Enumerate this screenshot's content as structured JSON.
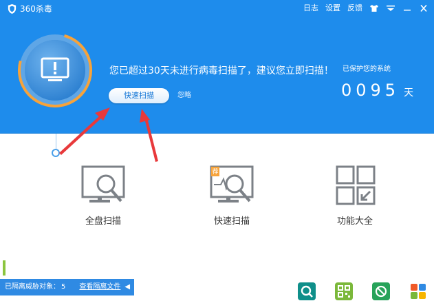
{
  "app": {
    "title": "360杀毒"
  },
  "menu": {
    "log": "日志",
    "settings": "设置",
    "feedback": "反馈",
    "skin_icon": "shirt-icon",
    "menu_icon": "menu-icon",
    "minimize_icon": "minimize-icon",
    "close_icon": "close-icon"
  },
  "banner": {
    "status_icon": "monitor-alert-icon",
    "message": "您已超过30天未进行病毒扫描了，建议您立即扫描！",
    "scan_button": "快速扫描",
    "ignore": "忽略",
    "protected_label": "已保护您的系统",
    "protected_days": "0095",
    "days_unit": "天"
  },
  "features": [
    {
      "label": "全盘扫描",
      "icon": "full-scan-icon"
    },
    {
      "label": "快速扫描",
      "icon": "quick-scan-icon"
    },
    {
      "label": "功能大全",
      "icon": "all-features-icon"
    }
  ],
  "isolation": {
    "label": "已隔离威胁对象：",
    "count": "5",
    "view_link": "查看隔离文件"
  },
  "tray_icons": [
    "search-tool-icon",
    "qrcode-icon",
    "block-icon",
    "app-store-icon"
  ],
  "colors": {
    "banner": "#1e8cec",
    "ring_orange": "#f7a33a",
    "arrow_red": "#e8393b",
    "icon_gray": "#7c8187",
    "green": "#8bc53f"
  }
}
